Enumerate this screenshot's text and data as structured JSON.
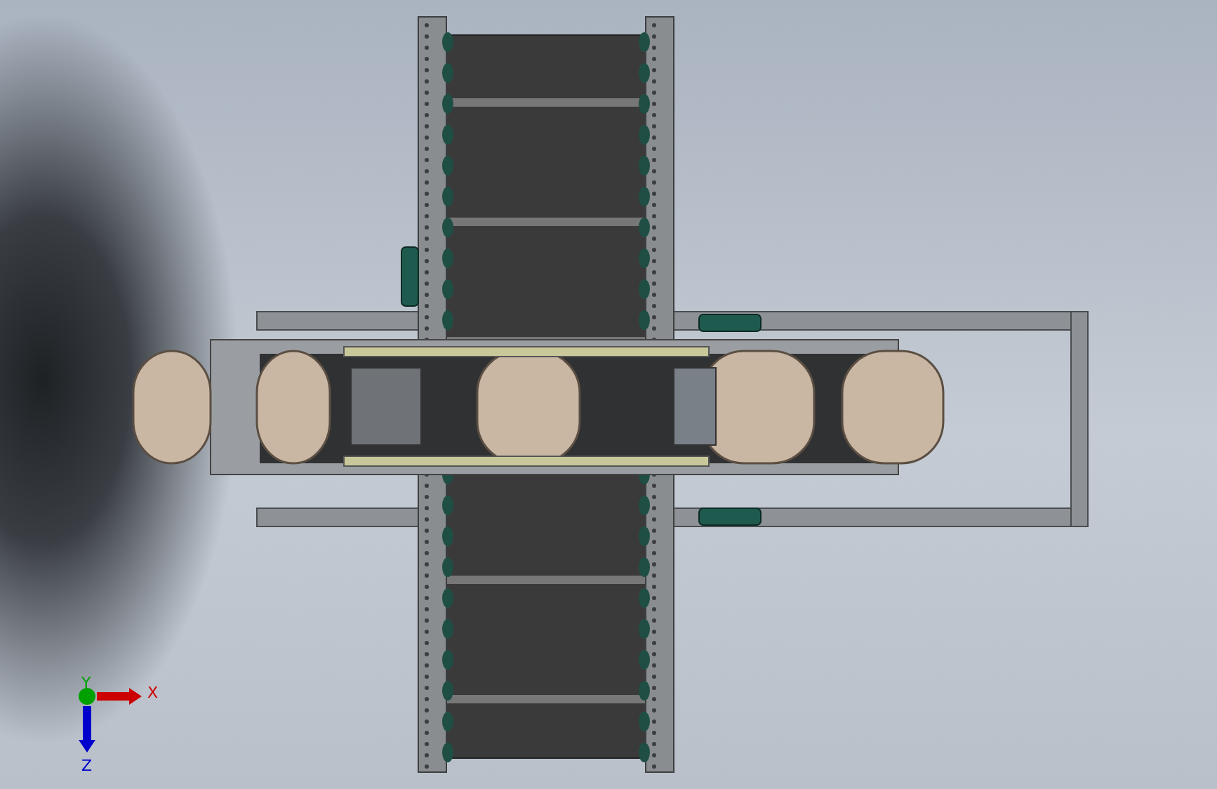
{
  "viewport": {
    "axis_triad": {
      "axes": [
        {
          "label": "X",
          "color": "#cc0000"
        },
        {
          "label": "Y",
          "color": "#00a000"
        },
        {
          "label": "Z",
          "color": "#0000cc"
        }
      ]
    }
  }
}
